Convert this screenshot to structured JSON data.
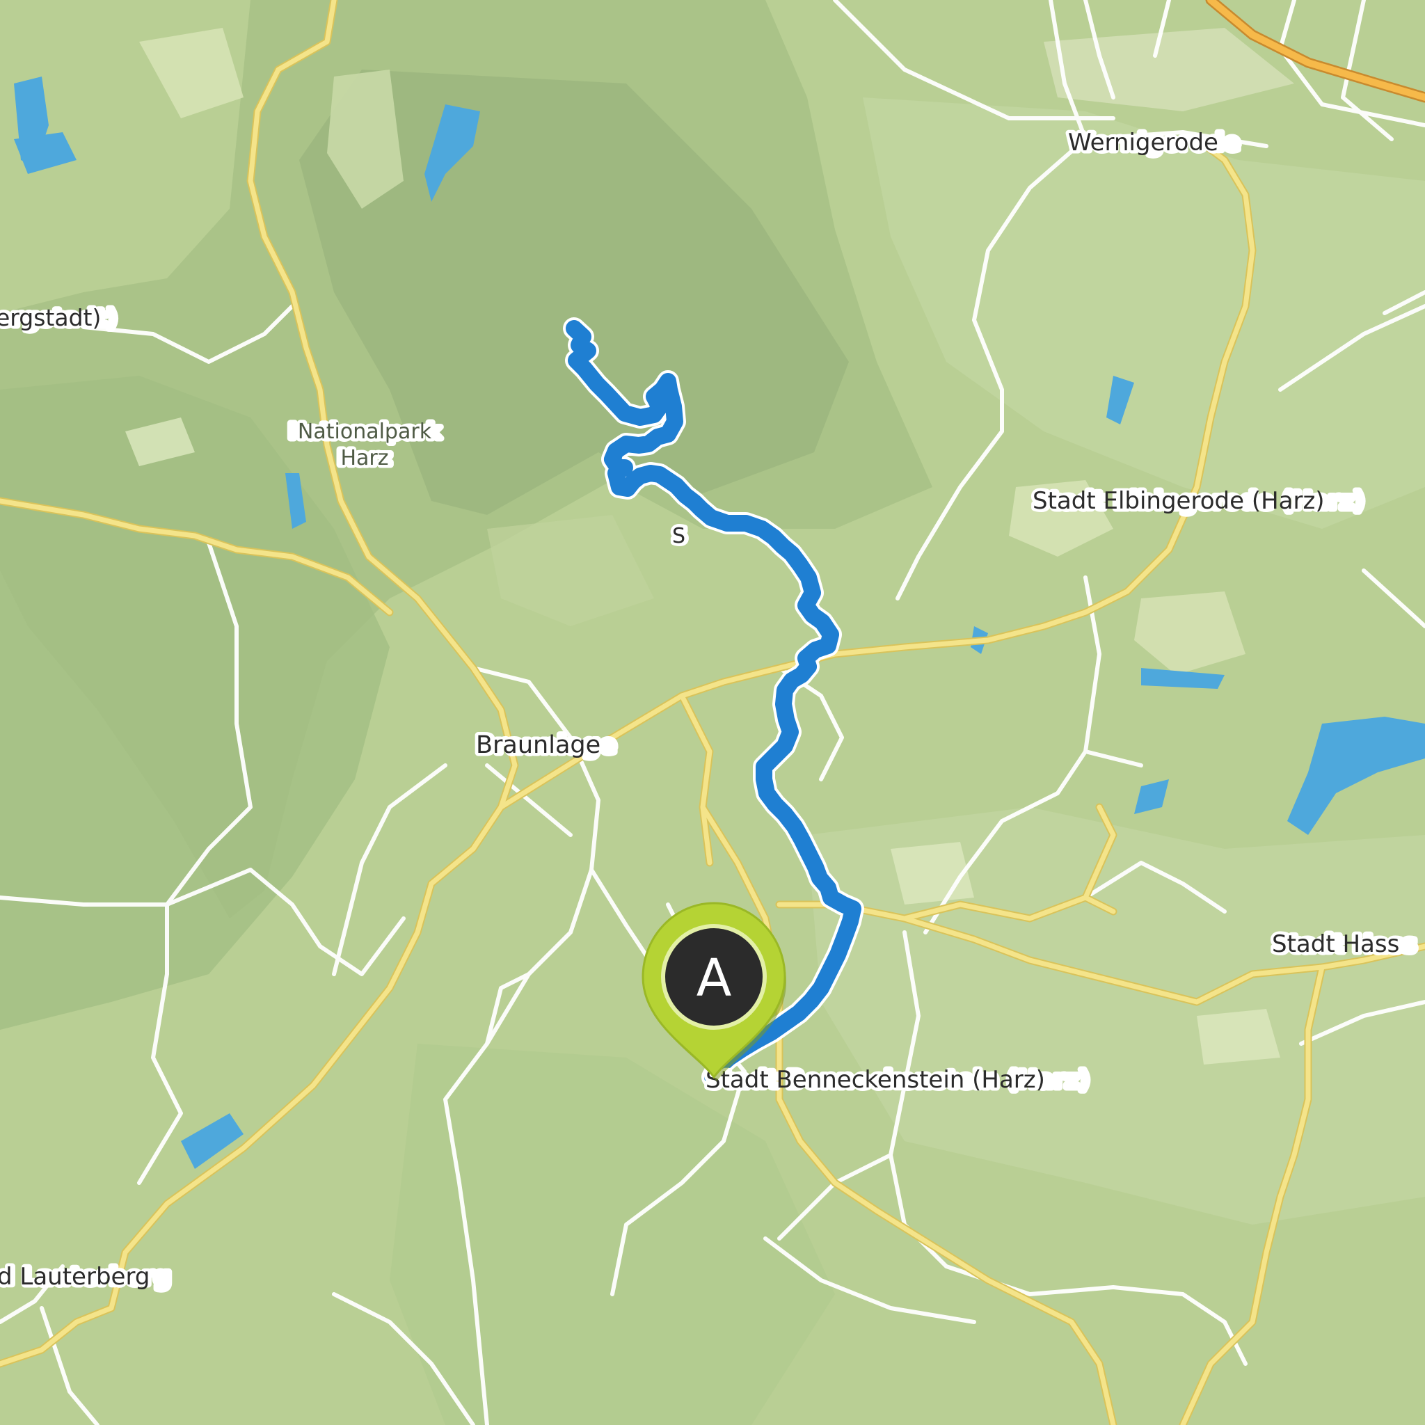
{
  "map": {
    "region": "Harz",
    "base_colors": {
      "land": "#b9cf94",
      "forest": "#9cb882",
      "park": "#a9c38b",
      "clearing": "#d6e2b4",
      "water": "#4ea8dc",
      "major_road": "#f4e48a",
      "major_road_casing": "#d9c35a",
      "minor_road": "#ffffff",
      "motorway": "#f6b94a",
      "route": "#1f7fd2"
    },
    "labels": {
      "wernigerode": "Wernigerode",
      "bergstadt": "ergstadt)",
      "nationalpark_line1": "Nationalpark",
      "nationalpark_line2": "Harz",
      "elbingerode": "Stadt Elbingerode (Harz)",
      "braunlage": "Braunlage",
      "hasselfelde": "Stadt Hass",
      "benneckenstein": "Stadt Benneckenstein (Harz)",
      "lauterberg": "d Lauterberg",
      "route_s": "S"
    },
    "marker": {
      "letter": "A",
      "icon": "map-pin-icon",
      "fill": "#2b2b2b",
      "ring": "#b5d334"
    }
  }
}
